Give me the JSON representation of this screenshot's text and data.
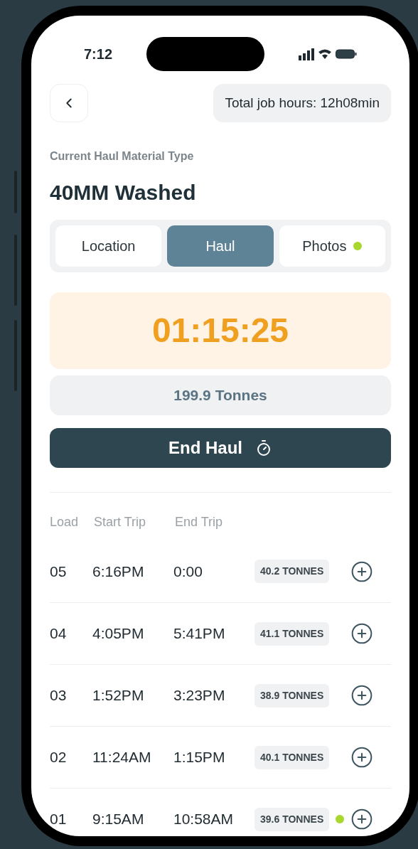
{
  "status_bar": {
    "time": "7:12"
  },
  "header": {
    "total_hours": "Total job hours: 12h08min"
  },
  "material": {
    "label": "Current Haul Material Type",
    "value": "40MM Washed"
  },
  "tabs": [
    {
      "label": "Location",
      "selected": false,
      "flagged": false
    },
    {
      "label": "Haul",
      "selected": true,
      "flagged": false
    },
    {
      "label": "Photos",
      "selected": false,
      "flagged": true
    }
  ],
  "timer": "01:15:25",
  "tonnes": "199.9 Tonnes",
  "end_button": "End Haul",
  "table": {
    "columns": [
      "Load",
      "Start Trip",
      "End Trip"
    ],
    "rows": [
      {
        "load": "05",
        "start": "6:16PM",
        "end": "0:00",
        "tonnes": "40.2 TONNES",
        "flagged": false
      },
      {
        "load": "04",
        "start": "4:05PM",
        "end": "5:41PM",
        "tonnes": "41.1 TONNES",
        "flagged": false
      },
      {
        "load": "03",
        "start": "1:52PM",
        "end": "3:23PM",
        "tonnes": "38.9 TONNES",
        "flagged": false
      },
      {
        "load": "02",
        "start": "11:24AM",
        "end": "1:15PM",
        "tonnes": "40.1 TONNES",
        "flagged": false
      },
      {
        "load": "01",
        "start": "9:15AM",
        "end": "10:58AM",
        "tonnes": "39.6 TONNES",
        "flagged": true
      }
    ]
  }
}
